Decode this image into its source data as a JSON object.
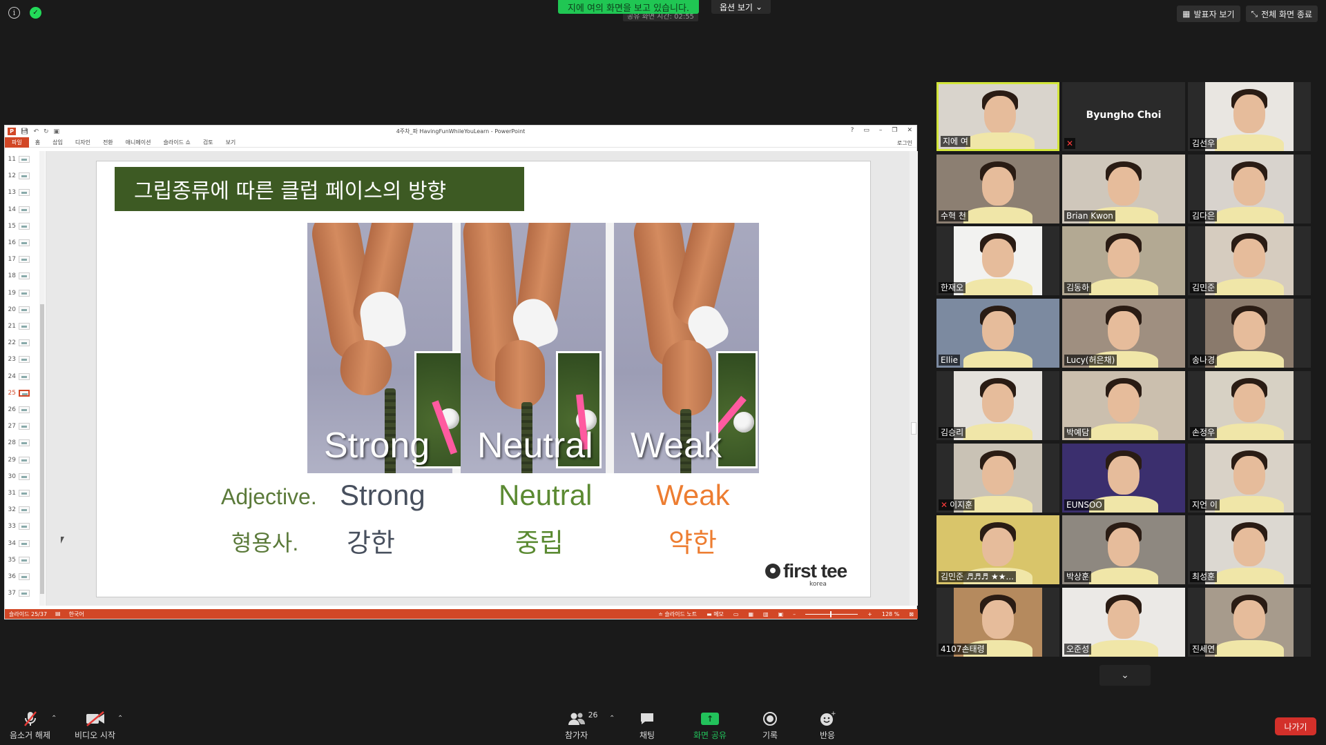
{
  "top": {
    "share_banner": "지에 여의 화면을 보고 있습니다.",
    "share_timer": "공유 화면 시간: 02:55",
    "view_options": "옵션 보기",
    "speaker_view": "발표자 보기",
    "exit_fullscreen": "전체 화면 종료"
  },
  "ppt": {
    "doc_title": "4주차_파 HavingFunWhileYouLearn - PowerPoint",
    "menu": [
      "파일",
      "홈",
      "삽입",
      "디자인",
      "전환",
      "애니메이션",
      "슬라이드 쇼",
      "검토",
      "보기"
    ],
    "login": "로그인",
    "window_buttons": [
      "?",
      "▭",
      "–",
      "❐",
      "✕"
    ],
    "thumbnails": [
      "11",
      "12",
      "13",
      "14",
      "15",
      "16",
      "17",
      "18",
      "19",
      "20",
      "21",
      "22",
      "23",
      "24",
      "25",
      "26",
      "27",
      "28",
      "29",
      "30",
      "31",
      "32",
      "33",
      "34",
      "35",
      "36",
      "37"
    ],
    "active_thumbnail": "25",
    "status": {
      "slide_info": "슬라이드 25/37",
      "language": "한국어",
      "notes": "슬라이드 노트",
      "comments": "메모",
      "zoom": "128 %"
    }
  },
  "slide": {
    "title": "그립종류에 따른 클럽 페이스의 방향",
    "photo_labels": [
      "Strong",
      "Neutral",
      "Weak"
    ],
    "row_label_en": "Adjective.",
    "row_label_ko": "형용사.",
    "terms": [
      {
        "en": "Strong",
        "ko": "강한",
        "color": "#48505e"
      },
      {
        "en": "Neutral",
        "ko": "중립",
        "color": "#5b8a32"
      },
      {
        "en": "Weak",
        "ko": "약한",
        "color": "#ed7d31"
      }
    ],
    "label_color": "#5b7a3a",
    "logo_text": "first tee",
    "logo_sub": "korea"
  },
  "participants": [
    {
      "name": "지에 여",
      "speaking": true,
      "muted": false,
      "video": true,
      "bg": "#d9d4cc"
    },
    {
      "name": "Byungho Choi",
      "speaking": false,
      "muted": true,
      "video": false,
      "bg": "#1f1f1f"
    },
    {
      "name": "김선우",
      "speaking": false,
      "muted": false,
      "video": true,
      "bg": "#e9e6e1"
    },
    {
      "name": "수혁 천",
      "speaking": false,
      "muted": false,
      "video": true,
      "bg": "#8c7f72"
    },
    {
      "name": "Brian Kwon",
      "speaking": false,
      "muted": false,
      "video": true,
      "bg": "#cfc7bb"
    },
    {
      "name": "김다은",
      "speaking": false,
      "muted": false,
      "video": true,
      "bg": "#d8d3cd"
    },
    {
      "name": "한재오",
      "speaking": false,
      "muted": false,
      "video": true,
      "bg": "#f2f2f0"
    },
    {
      "name": "김동하",
      "speaking": false,
      "muted": false,
      "video": true,
      "bg": "#b3a993"
    },
    {
      "name": "김민준",
      "speaking": false,
      "muted": false,
      "video": true,
      "bg": "#d6ccbf"
    },
    {
      "name": "Ellie",
      "speaking": false,
      "muted": false,
      "video": true,
      "bg": "#7c8aa0"
    },
    {
      "name": "Lucy(허은채)",
      "speaking": false,
      "muted": false,
      "video": true,
      "bg": "#9f8f80"
    },
    {
      "name": "송나경",
      "speaking": false,
      "muted": false,
      "video": true,
      "bg": "#8a7a6c"
    },
    {
      "name": "김승리",
      "speaking": false,
      "muted": false,
      "video": true,
      "bg": "#e4e1dc"
    },
    {
      "name": "박예담",
      "speaking": false,
      "muted": false,
      "video": true,
      "bg": "#cbbfae"
    },
    {
      "name": "손정우",
      "speaking": false,
      "muted": false,
      "video": true,
      "bg": "#d7d1c4"
    },
    {
      "name": "이지훈",
      "speaking": false,
      "muted": true,
      "video": true,
      "bg": "#c9c2b5"
    },
    {
      "name": "EUNSOO",
      "speaking": false,
      "muted": false,
      "video": true,
      "bg": "#3b2f6e"
    },
    {
      "name": "지언 이",
      "speaking": false,
      "muted": false,
      "video": true,
      "bg": "#d9d2c7"
    },
    {
      "name": "김민준 ♬♬♬ ★★...",
      "speaking": false,
      "muted": false,
      "video": true,
      "bg": "#d9c56a"
    },
    {
      "name": "박상훈",
      "speaking": false,
      "muted": false,
      "video": true,
      "bg": "#8e8880"
    },
    {
      "name": "최성훈",
      "speaking": false,
      "muted": false,
      "video": true,
      "bg": "#dcd8d1"
    },
    {
      "name": "4107손태령",
      "speaking": false,
      "muted": false,
      "video": true,
      "bg": "#b58a5e"
    },
    {
      "name": "오준성",
      "speaking": false,
      "muted": false,
      "video": true,
      "bg": "#ebe9e6"
    },
    {
      "name": "진세연",
      "speaking": false,
      "muted": false,
      "video": true,
      "bg": "#a79b8c"
    }
  ],
  "toolbar": {
    "unmute": "음소거 해제",
    "start_video": "비디오 시작",
    "participants": "참가자",
    "participants_count": "26",
    "chat": "채팅",
    "share_screen": "화면 공유",
    "record": "기록",
    "reactions": "반응",
    "leave": "나가기"
  }
}
